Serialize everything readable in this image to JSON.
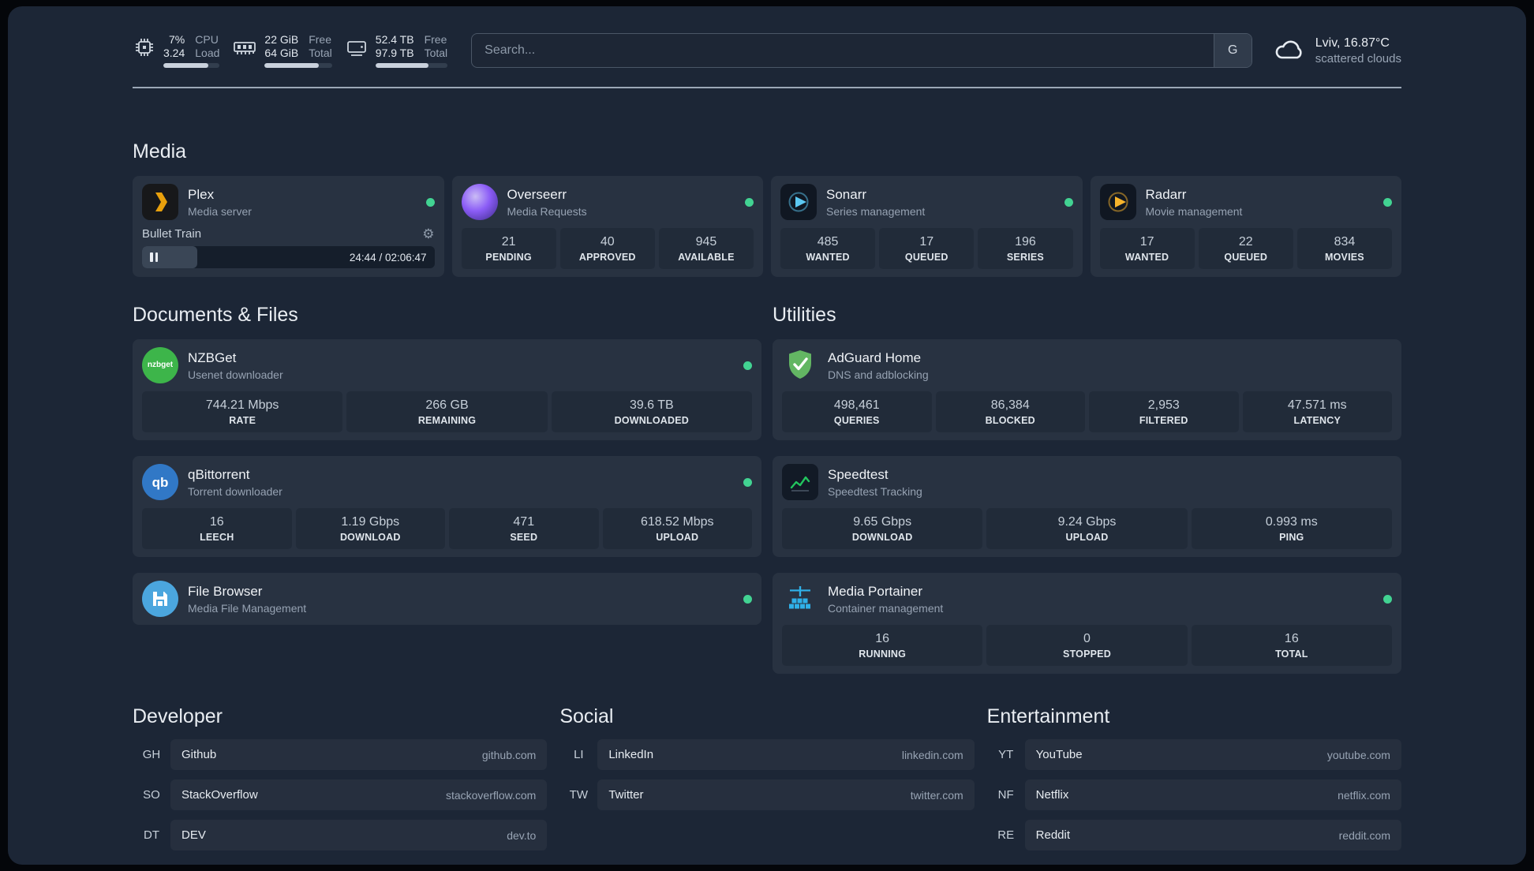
{
  "colors": {
    "status_online": "#42d392",
    "plex_brand": "#e8a00c",
    "overseerr_brand": "#8b5cf6",
    "sonarr_brand": "#5cc8f2",
    "radarr_brand": "#f7b42c",
    "nzbget_brand": "#3db54a",
    "qbittorrent_brand": "#3178c6",
    "filebrowser_brand": "#4ba6de",
    "adguard_brand": "#63b663",
    "speedtest_accent": "#22c55e",
    "portainer_brand": "#2fb0e8"
  },
  "topbar": {
    "cpu": {
      "value1": "7%",
      "value2": "3.24",
      "label1": "CPU",
      "label2": "Load",
      "bar_fill": "80%"
    },
    "memory": {
      "value1": "22 GiB",
      "value2": "64 GiB",
      "label1": "Free",
      "label2": "Total",
      "bar_fill": "80%"
    },
    "disk": {
      "value1": "52.4 TB",
      "value2": "97.9 TB",
      "label1": "Free",
      "label2": "Total",
      "bar_fill": "74%"
    },
    "search": {
      "placeholder": "Search...",
      "provider_label": "G"
    },
    "weather": {
      "location": "Lviv, 16.87°C",
      "condition": "scattered clouds"
    }
  },
  "media": {
    "heading": "Media",
    "plex": {
      "name": "Plex",
      "desc": "Media server",
      "now_playing": "Bullet Train",
      "time": "24:44 / 02:06:47",
      "progress": "19%"
    },
    "overseerr": {
      "name": "Overseerr",
      "desc": "Media Requests",
      "stats": [
        {
          "value": "21",
          "label": "PENDING"
        },
        {
          "value": "40",
          "label": "APPROVED"
        },
        {
          "value": "945",
          "label": "AVAILABLE"
        }
      ]
    },
    "sonarr": {
      "name": "Sonarr",
      "desc": "Series management",
      "stats": [
        {
          "value": "485",
          "label": "WANTED"
        },
        {
          "value": "17",
          "label": "QUEUED"
        },
        {
          "value": "196",
          "label": "SERIES"
        }
      ]
    },
    "radarr": {
      "name": "Radarr",
      "desc": "Movie management",
      "stats": [
        {
          "value": "17",
          "label": "WANTED"
        },
        {
          "value": "22",
          "label": "QUEUED"
        },
        {
          "value": "834",
          "label": "MOVIES"
        }
      ]
    }
  },
  "documents": {
    "heading": "Documents & Files",
    "nzbget": {
      "name": "NZBGet",
      "desc": "Usenet downloader",
      "icon_text": "nzbget",
      "stats": [
        {
          "value": "744.21 Mbps",
          "label": "RATE"
        },
        {
          "value": "266 GB",
          "label": "REMAINING"
        },
        {
          "value": "39.6 TB",
          "label": "DOWNLOADED"
        }
      ]
    },
    "qbittorrent": {
      "name": "qBittorrent",
      "desc": "Torrent downloader",
      "icon_text": "qb",
      "stats": [
        {
          "value": "16",
          "label": "LEECH"
        },
        {
          "value": "1.19 Gbps",
          "label": "DOWNLOAD"
        },
        {
          "value": "471",
          "label": "SEED"
        },
        {
          "value": "618.52 Mbps",
          "label": "UPLOAD"
        }
      ]
    },
    "filebrowser": {
      "name": "File Browser",
      "desc": "Media File Management"
    }
  },
  "utilities": {
    "heading": "Utilities",
    "adguard": {
      "name": "AdGuard Home",
      "desc": "DNS and adblocking",
      "stats": [
        {
          "value": "498,461",
          "label": "QUERIES"
        },
        {
          "value": "86,384",
          "label": "BLOCKED"
        },
        {
          "value": "2,953",
          "label": "FILTERED"
        },
        {
          "value": "47.571 ms",
          "label": "LATENCY"
        }
      ]
    },
    "speedtest": {
      "name": "Speedtest",
      "desc": "Speedtest Tracking",
      "stats": [
        {
          "value": "9.65 Gbps",
          "label": "DOWNLOAD"
        },
        {
          "value": "9.24 Gbps",
          "label": "UPLOAD"
        },
        {
          "value": "0.993 ms",
          "label": "PING"
        }
      ]
    },
    "portainer": {
      "name": "Media Portainer",
      "desc": "Container management",
      "stats": [
        {
          "value": "16",
          "label": "RUNNING"
        },
        {
          "value": "0",
          "label": "STOPPED"
        },
        {
          "value": "16",
          "label": "TOTAL"
        }
      ]
    }
  },
  "bookmarks": {
    "developer": {
      "heading": "Developer",
      "items": [
        {
          "abbr": "GH",
          "name": "Github",
          "url": "github.com"
        },
        {
          "abbr": "SO",
          "name": "StackOverflow",
          "url": "stackoverflow.com"
        },
        {
          "abbr": "DT",
          "name": "DEV",
          "url": "dev.to"
        }
      ]
    },
    "social": {
      "heading": "Social",
      "items": [
        {
          "abbr": "LI",
          "name": "LinkedIn",
          "url": "linkedin.com"
        },
        {
          "abbr": "TW",
          "name": "Twitter",
          "url": "twitter.com"
        }
      ]
    },
    "entertainment": {
      "heading": "Entertainment",
      "items": [
        {
          "abbr": "YT",
          "name": "YouTube",
          "url": "youtube.com"
        },
        {
          "abbr": "NF",
          "name": "Netflix",
          "url": "netflix.com"
        },
        {
          "abbr": "RE",
          "name": "Reddit",
          "url": "reddit.com"
        }
      ]
    }
  }
}
